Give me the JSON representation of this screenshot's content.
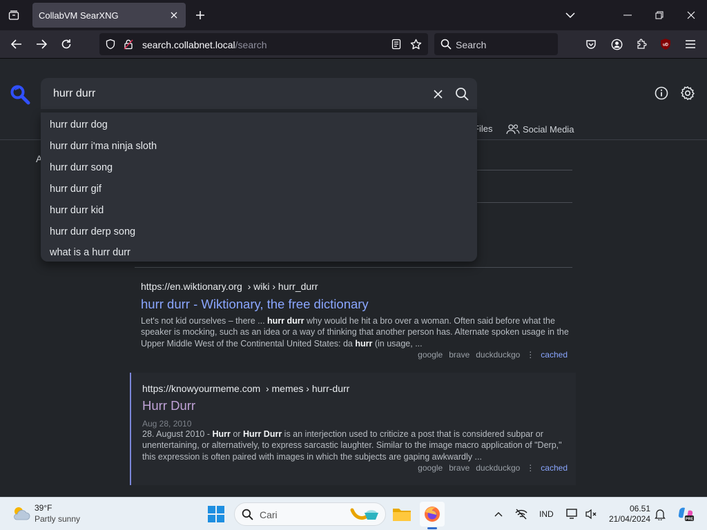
{
  "browser": {
    "tab_title": "CollabVM SearXNG",
    "url_host": "search.collabnet.local",
    "url_path": "/search",
    "search_placeholder": "Search"
  },
  "search": {
    "query": "hurr durr",
    "suggestions": [
      "hurr durr dog",
      "hurr durr i'ma ninja sloth",
      "hurr durr song",
      "hurr durr gif",
      "hurr durr kid",
      "hurr durr derp song",
      "what is a hurr durr"
    ]
  },
  "categories": {
    "files_partial": "Files",
    "social": "Social Media"
  },
  "partial_left_text": "A",
  "results": [
    {
      "url_host": "https://en.wiktionary.org",
      "url_path": "› wiki › hurr_durr",
      "title": "hurr durr - Wiktionary, the free dictionary",
      "content_parts": [
        "Let's not kid ourselves – there ... ",
        "hurr durr",
        " why would he hit a bro over a woman. Often said before what the speaker is mocking, such as an idea or a way of thinking that another person has. Alternate spoken usage in the Upper Middle West of the Continental United States: da ",
        "hurr",
        " (in usage, ..."
      ],
      "engines": [
        "google",
        "brave",
        "duckduckgo"
      ],
      "cached": "cached"
    },
    {
      "url_host": "https://knowyourmeme.com",
      "url_path": "› memes › hurr-durr",
      "title": "Hurr Durr",
      "date": "Aug 28, 2010",
      "content_parts": [
        "28. August 2010 - ",
        "Hurr",
        " or ",
        "Hurr Durr",
        " is an interjection used to criticize a post that is considered subpar or unentertaining, or alternatively, to express sarcastic laughter. Similar to the image macro application of \"Derp,\" this expression is often paired with images in which the subjects are gaping awkwardly ..."
      ],
      "engines": [
        "google",
        "brave",
        "duckduckgo"
      ],
      "cached": "cached"
    }
  ],
  "taskbar": {
    "weather_temp": "39°F",
    "weather_desc": "Partly sunny",
    "search_placeholder": "Cari",
    "lang": "IND",
    "time": "06.51",
    "date": "21/04/2024"
  },
  "colors": {
    "accent": "#3050ff",
    "link": "#8aa6ff",
    "visited": "#bfa2d6",
    "page_bg": "#222529"
  }
}
